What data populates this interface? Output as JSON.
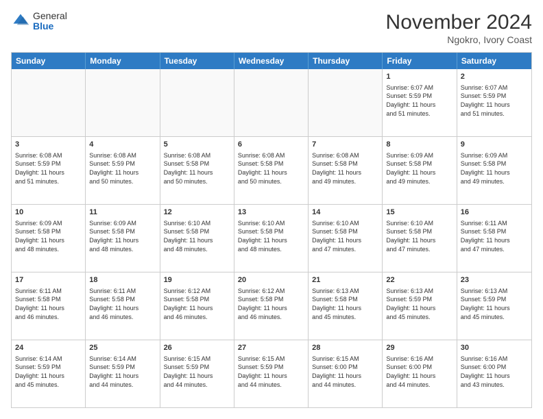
{
  "logo": {
    "general": "General",
    "blue": "Blue"
  },
  "title": "November 2024",
  "location": "Ngokro, Ivory Coast",
  "header_days": [
    "Sunday",
    "Monday",
    "Tuesday",
    "Wednesday",
    "Thursday",
    "Friday",
    "Saturday"
  ],
  "rows": [
    [
      {
        "day": "",
        "info": "",
        "empty": true
      },
      {
        "day": "",
        "info": "",
        "empty": true
      },
      {
        "day": "",
        "info": "",
        "empty": true
      },
      {
        "day": "",
        "info": "",
        "empty": true
      },
      {
        "day": "",
        "info": "",
        "empty": true
      },
      {
        "day": "1",
        "info": "Sunrise: 6:07 AM\nSunset: 5:59 PM\nDaylight: 11 hours\nand 51 minutes."
      },
      {
        "day": "2",
        "info": "Sunrise: 6:07 AM\nSunset: 5:59 PM\nDaylight: 11 hours\nand 51 minutes."
      }
    ],
    [
      {
        "day": "3",
        "info": "Sunrise: 6:08 AM\nSunset: 5:59 PM\nDaylight: 11 hours\nand 51 minutes."
      },
      {
        "day": "4",
        "info": "Sunrise: 6:08 AM\nSunset: 5:59 PM\nDaylight: 11 hours\nand 50 minutes."
      },
      {
        "day": "5",
        "info": "Sunrise: 6:08 AM\nSunset: 5:58 PM\nDaylight: 11 hours\nand 50 minutes."
      },
      {
        "day": "6",
        "info": "Sunrise: 6:08 AM\nSunset: 5:58 PM\nDaylight: 11 hours\nand 50 minutes."
      },
      {
        "day": "7",
        "info": "Sunrise: 6:08 AM\nSunset: 5:58 PM\nDaylight: 11 hours\nand 49 minutes."
      },
      {
        "day": "8",
        "info": "Sunrise: 6:09 AM\nSunset: 5:58 PM\nDaylight: 11 hours\nand 49 minutes."
      },
      {
        "day": "9",
        "info": "Sunrise: 6:09 AM\nSunset: 5:58 PM\nDaylight: 11 hours\nand 49 minutes."
      }
    ],
    [
      {
        "day": "10",
        "info": "Sunrise: 6:09 AM\nSunset: 5:58 PM\nDaylight: 11 hours\nand 48 minutes."
      },
      {
        "day": "11",
        "info": "Sunrise: 6:09 AM\nSunset: 5:58 PM\nDaylight: 11 hours\nand 48 minutes."
      },
      {
        "day": "12",
        "info": "Sunrise: 6:10 AM\nSunset: 5:58 PM\nDaylight: 11 hours\nand 48 minutes."
      },
      {
        "day": "13",
        "info": "Sunrise: 6:10 AM\nSunset: 5:58 PM\nDaylight: 11 hours\nand 48 minutes."
      },
      {
        "day": "14",
        "info": "Sunrise: 6:10 AM\nSunset: 5:58 PM\nDaylight: 11 hours\nand 47 minutes."
      },
      {
        "day": "15",
        "info": "Sunrise: 6:10 AM\nSunset: 5:58 PM\nDaylight: 11 hours\nand 47 minutes."
      },
      {
        "day": "16",
        "info": "Sunrise: 6:11 AM\nSunset: 5:58 PM\nDaylight: 11 hours\nand 47 minutes."
      }
    ],
    [
      {
        "day": "17",
        "info": "Sunrise: 6:11 AM\nSunset: 5:58 PM\nDaylight: 11 hours\nand 46 minutes."
      },
      {
        "day": "18",
        "info": "Sunrise: 6:11 AM\nSunset: 5:58 PM\nDaylight: 11 hours\nand 46 minutes."
      },
      {
        "day": "19",
        "info": "Sunrise: 6:12 AM\nSunset: 5:58 PM\nDaylight: 11 hours\nand 46 minutes."
      },
      {
        "day": "20",
        "info": "Sunrise: 6:12 AM\nSunset: 5:58 PM\nDaylight: 11 hours\nand 46 minutes."
      },
      {
        "day": "21",
        "info": "Sunrise: 6:13 AM\nSunset: 5:58 PM\nDaylight: 11 hours\nand 45 minutes."
      },
      {
        "day": "22",
        "info": "Sunrise: 6:13 AM\nSunset: 5:59 PM\nDaylight: 11 hours\nand 45 minutes."
      },
      {
        "day": "23",
        "info": "Sunrise: 6:13 AM\nSunset: 5:59 PM\nDaylight: 11 hours\nand 45 minutes."
      }
    ],
    [
      {
        "day": "24",
        "info": "Sunrise: 6:14 AM\nSunset: 5:59 PM\nDaylight: 11 hours\nand 45 minutes."
      },
      {
        "day": "25",
        "info": "Sunrise: 6:14 AM\nSunset: 5:59 PM\nDaylight: 11 hours\nand 44 minutes."
      },
      {
        "day": "26",
        "info": "Sunrise: 6:15 AM\nSunset: 5:59 PM\nDaylight: 11 hours\nand 44 minutes."
      },
      {
        "day": "27",
        "info": "Sunrise: 6:15 AM\nSunset: 5:59 PM\nDaylight: 11 hours\nand 44 minutes."
      },
      {
        "day": "28",
        "info": "Sunrise: 6:15 AM\nSunset: 6:00 PM\nDaylight: 11 hours\nand 44 minutes."
      },
      {
        "day": "29",
        "info": "Sunrise: 6:16 AM\nSunset: 6:00 PM\nDaylight: 11 hours\nand 44 minutes."
      },
      {
        "day": "30",
        "info": "Sunrise: 6:16 AM\nSunset: 6:00 PM\nDaylight: 11 hours\nand 43 minutes."
      }
    ]
  ]
}
